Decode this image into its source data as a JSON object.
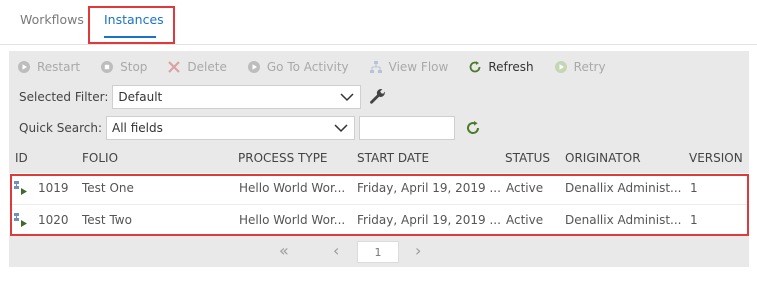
{
  "tabs": {
    "workflows": "Workflows",
    "instances": "Instances"
  },
  "toolbar": {
    "restart": "Restart",
    "stop": "Stop",
    "delete": "Delete",
    "go_to_activity": "Go To Activity",
    "view_flow": "View Flow",
    "refresh": "Refresh",
    "retry": "Retry"
  },
  "filter": {
    "label": "Selected Filter:",
    "value": "Default"
  },
  "search": {
    "label": "Quick Search:",
    "value": "All fields",
    "text": ""
  },
  "columns": {
    "id": "ID",
    "folio": "FOLIO",
    "process_type": "PROCESS TYPE",
    "start_date": "START DATE",
    "status": "STATUS",
    "originator": "ORIGINATOR",
    "version": "VERSION"
  },
  "rows": [
    {
      "id": "1019",
      "folio": "Test One",
      "process_type": "Hello World Wor...",
      "start_date": "Friday, April 19, 2019 ...",
      "status": "Active",
      "originator": "Denallix Administ...",
      "version": "1"
    },
    {
      "id": "1020",
      "folio": "Test Two",
      "process_type": "Hello World Wor...",
      "start_date": "Friday, April 19, 2019 ...",
      "status": "Active",
      "originator": "Denallix Administ...",
      "version": "1"
    }
  ],
  "pager": {
    "first": "«",
    "prev": "‹",
    "page": "1",
    "next": "›"
  },
  "colors": {
    "accent": "#1a73c4",
    "highlight": "#e0393b",
    "refresh_green": "#4a7a2a"
  }
}
